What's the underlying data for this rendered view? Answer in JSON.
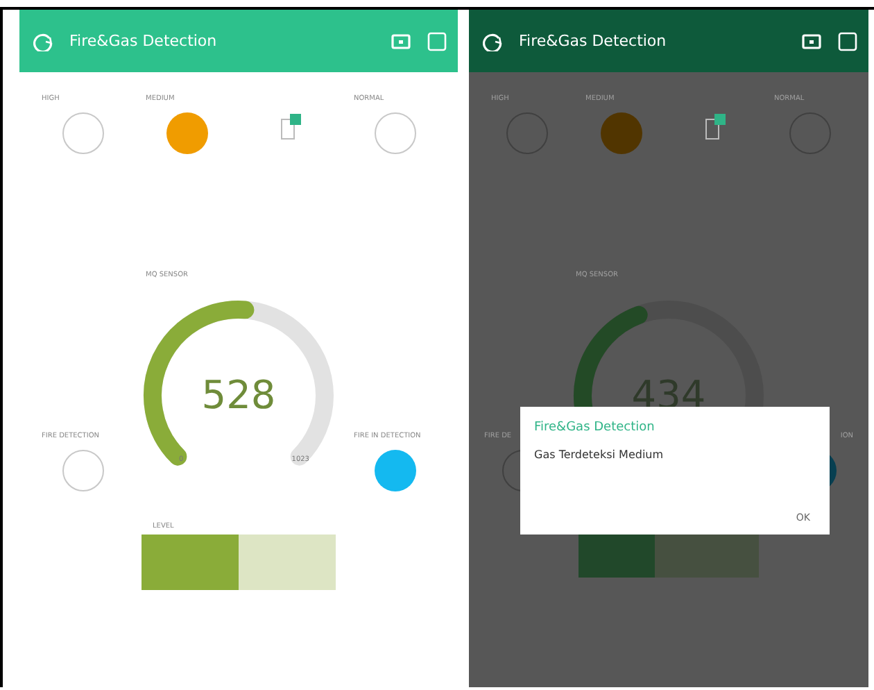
{
  "screens": [
    {
      "title": "Fire&Gas Detection",
      "top_leds": [
        {
          "label": "HIGH",
          "on": false
        },
        {
          "label": "MEDIUM",
          "on": true,
          "color": "#f09c00"
        },
        {
          "kind": "icon"
        },
        {
          "label": "NORMAL",
          "on": false
        }
      ],
      "gauge": {
        "label": "MQ SENSOR",
        "value": "528",
        "min": "0",
        "max": "1023"
      },
      "bottom_leds": [
        {
          "label": "FIRE DETECTION",
          "on": false
        },
        {
          "label": "FIRE IN DETECTION",
          "on": true,
          "color": "#14b9f0"
        }
      ],
      "level_bar": {
        "label": "LEVEL",
        "level": 0.5
      }
    },
    {
      "title": "Fire&Gas Detection",
      "top_leds": [
        {
          "label": "HIGH",
          "on": false
        },
        {
          "label": "MEDIUM",
          "on": true,
          "color": "#513500"
        },
        {
          "kind": "icon"
        },
        {
          "label": "NORMAL",
          "on": false
        }
      ],
      "gauge": {
        "label": "MQ SENSOR",
        "value": "434"
      },
      "bottom_leds": [
        {
          "label": "FIRE DE",
          "on": false
        },
        {
          "label": "ION",
          "on": true,
          "color": "#073f51"
        }
      ],
      "level_bar": {
        "level": 0.42
      },
      "dialog": {
        "title": "Fire&Gas Detection",
        "message": "Gas Terdeteksi Medium",
        "button": "OK"
      }
    }
  ]
}
